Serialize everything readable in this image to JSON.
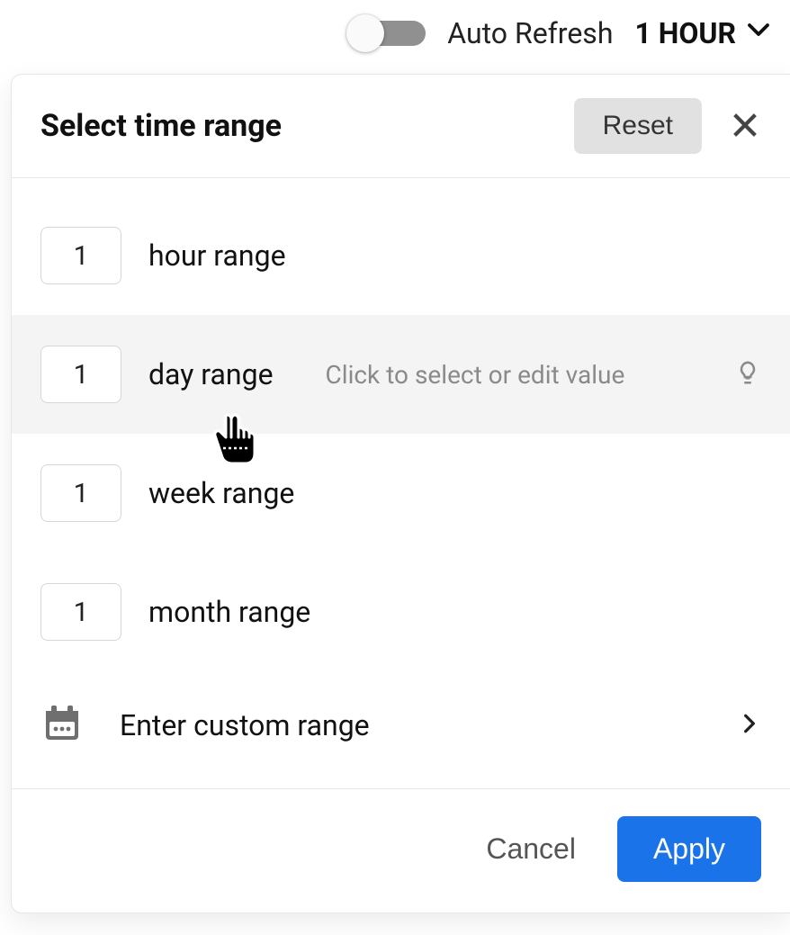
{
  "topbar": {
    "auto_refresh_label": "Auto Refresh",
    "dropdown_value": "1 HOUR"
  },
  "panel": {
    "title": "Select time range",
    "reset_label": "Reset",
    "hint_text": "Click to select or edit value",
    "rows": [
      {
        "value": "1",
        "unit": "hour range"
      },
      {
        "value": "1",
        "unit": "day range"
      },
      {
        "value": "1",
        "unit": "week range"
      },
      {
        "value": "1",
        "unit": "month range"
      }
    ],
    "custom_label": "Enter custom range",
    "cancel_label": "Cancel",
    "apply_label": "Apply"
  }
}
